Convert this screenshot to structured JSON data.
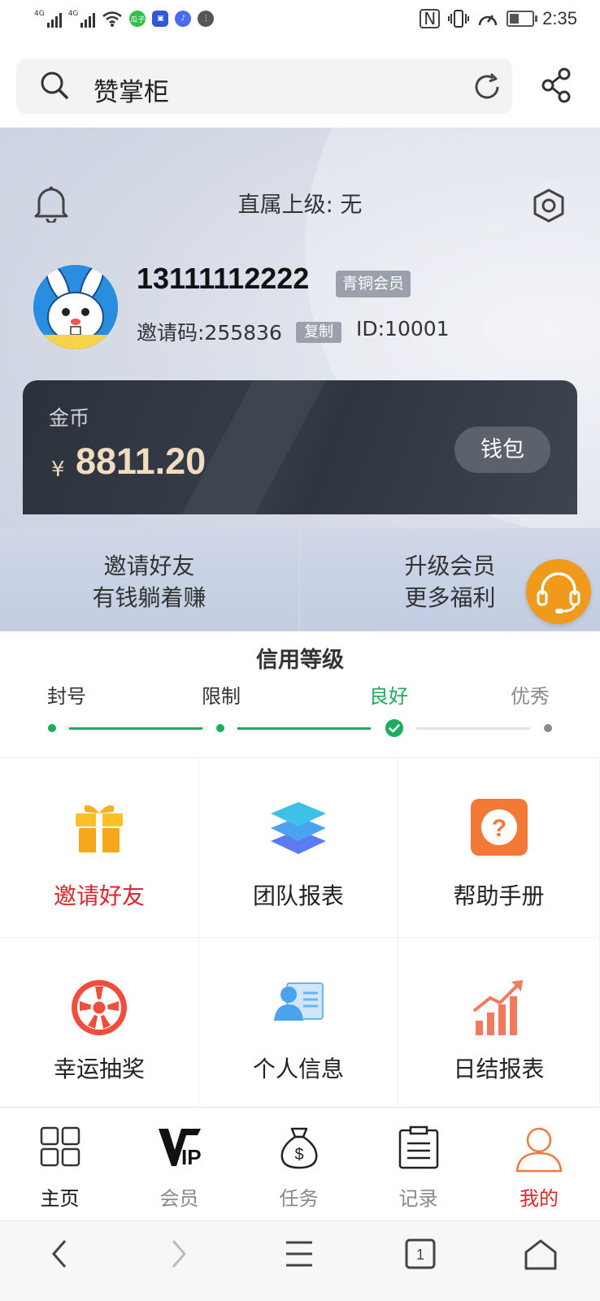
{
  "status_bar": {
    "network_1": "4G",
    "network_2": "4G",
    "time": "2:35",
    "battery_level": 0.4,
    "app_badge_1": "瓜子",
    "app_badge_1_color": "#2fbf4a",
    "app_badge_2_color": "#3157d6",
    "app_badge_3_color": "#4b6bf2"
  },
  "search": {
    "value": "赞掌柜"
  },
  "profile": {
    "superior_label": "直属上级: 无",
    "phone": "13111112222",
    "member_level": "青铜会员",
    "invite_code": "邀请码:255836",
    "copy_label": "复制",
    "user_id": "ID:10001"
  },
  "coins": {
    "label": "金币",
    "currency_symbol": "¥",
    "amount": "8811.20",
    "wallet_label": "钱包"
  },
  "banners": {
    "left_line1": "邀请好友",
    "left_line2": "有钱躺着赚",
    "right_line1": "升级会员",
    "right_line2": "更多福利"
  },
  "credit": {
    "title": "信用等级",
    "levels": [
      "封号",
      "限制",
      "良好",
      "优秀"
    ],
    "current_level_index": 2,
    "active_color": "#1aad5b",
    "inactive_color": "#8a8a8a"
  },
  "grid": {
    "items": [
      {
        "label": "邀请好友",
        "icon": "gift-icon",
        "highlight": true
      },
      {
        "label": "团队报表",
        "icon": "layers-icon",
        "highlight": false
      },
      {
        "label": "帮助手册",
        "icon": "help-icon",
        "highlight": false
      },
      {
        "label": "幸运抽奖",
        "icon": "wheel-icon",
        "highlight": false
      },
      {
        "label": "个人信息",
        "icon": "id-card-icon",
        "highlight": false
      },
      {
        "label": "日结报表",
        "icon": "chart-up-icon",
        "highlight": false
      }
    ],
    "highlight_color": "#e0262a"
  },
  "tabs": [
    {
      "label": "主页",
      "icon": "grid-icon",
      "state": "default"
    },
    {
      "label": "会员",
      "icon": "vip-icon",
      "state": "muted"
    },
    {
      "label": "任务",
      "icon": "money-bag-icon",
      "state": "muted"
    },
    {
      "label": "记录",
      "icon": "clipboard-icon",
      "state": "muted"
    },
    {
      "label": "我的",
      "icon": "user-icon",
      "state": "active"
    }
  ],
  "colors": {
    "accent": "#f07a3c",
    "tab_active": "#e0262a",
    "orange_cs": "#f09a1c"
  }
}
